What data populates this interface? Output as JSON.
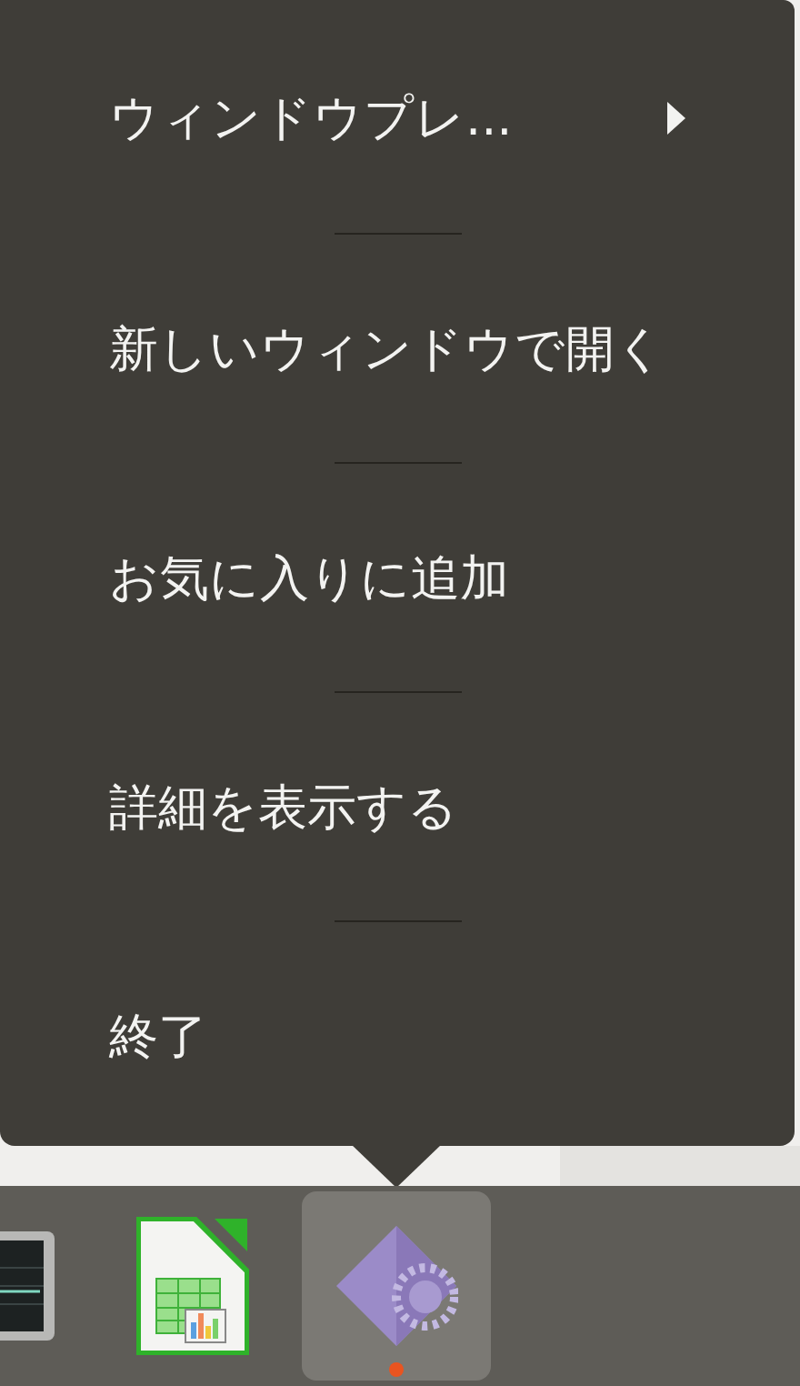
{
  "menu": {
    "items": [
      {
        "label": "ウィンドウプレ...",
        "has_submenu": true
      },
      {
        "label": "新しいウィンドウで開く",
        "has_submenu": false
      },
      {
        "label": "お気に入りに追加",
        "has_submenu": false
      },
      {
        "label": "詳細を表示する",
        "has_submenu": false
      },
      {
        "label": "終了",
        "has_submenu": false
      }
    ]
  },
  "dock": {
    "items": [
      {
        "kind": "monitor",
        "selected": false,
        "running": false
      },
      {
        "kind": "spreadsheet",
        "selected": false,
        "running": false
      },
      {
        "kind": "settings",
        "selected": true,
        "running": true
      }
    ]
  }
}
